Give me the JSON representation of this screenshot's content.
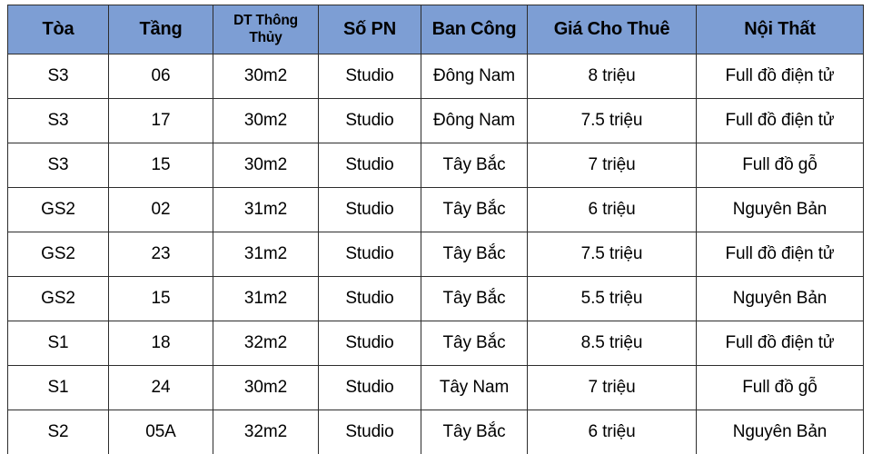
{
  "table": {
    "columns": [
      {
        "key": "toa",
        "label": "Tòa",
        "two_line": false
      },
      {
        "key": "tang",
        "label": "Tầng",
        "two_line": false
      },
      {
        "key": "dt",
        "label": "DT Thông Thủy",
        "two_line": true
      },
      {
        "key": "sopn",
        "label": "Số PN",
        "two_line": false
      },
      {
        "key": "bancong",
        "label": "Ban Công",
        "two_line": false
      },
      {
        "key": "gia",
        "label": "Giá Cho Thuê",
        "two_line": false
      },
      {
        "key": "noithat",
        "label": "Nội Thất",
        "two_line": false
      }
    ],
    "header_line1": "DT Thông",
    "header_line2": "Thủy",
    "rows": [
      {
        "toa": "S3",
        "tang": "06",
        "dt": "30m2",
        "sopn": "Studio",
        "bancong": "Đông Nam",
        "gia": "8 triệu",
        "noithat": "Full đồ điện tử"
      },
      {
        "toa": "S3",
        "tang": "17",
        "dt": "30m2",
        "sopn": "Studio",
        "bancong": "Đông Nam",
        "gia": "7.5 triệu",
        "noithat": "Full đồ điện tử"
      },
      {
        "toa": "S3",
        "tang": "15",
        "dt": "30m2",
        "sopn": "Studio",
        "bancong": "Tây Bắc",
        "gia": "7 triệu",
        "noithat": "Full đồ gỗ"
      },
      {
        "toa": "GS2",
        "tang": "02",
        "dt": "31m2",
        "sopn": "Studio",
        "bancong": "Tây Bắc",
        "gia": "6 triệu",
        "noithat": "Nguyên Bản"
      },
      {
        "toa": "GS2",
        "tang": "23",
        "dt": "31m2",
        "sopn": "Studio",
        "bancong": "Tây Bắc",
        "gia": "7.5 triệu",
        "noithat": "Full đồ điện tử"
      },
      {
        "toa": "GS2",
        "tang": "15",
        "dt": "31m2",
        "sopn": "Studio",
        "bancong": "Tây Bắc",
        "gia": "5.5 triệu",
        "noithat": "Nguyên Bản"
      },
      {
        "toa": "S1",
        "tang": "18",
        "dt": "32m2",
        "sopn": "Studio",
        "bancong": "Tây Bắc",
        "gia": "8.5 triệu",
        "noithat": "Full đồ điện tử"
      },
      {
        "toa": "S1",
        "tang": "24",
        "dt": "30m2",
        "sopn": "Studio",
        "bancong": "Tây Nam",
        "gia": "7 triệu",
        "noithat": "Full đồ gỗ"
      },
      {
        "toa": "S2",
        "tang": "05A",
        "dt": "32m2",
        "sopn": "Studio",
        "bancong": "Tây Bắc",
        "gia": "6 triệu",
        "noithat": "Nguyên Bản"
      }
    ]
  },
  "colors": {
    "header_background": "#7d9ed4",
    "border": "#2d2d2d",
    "cell_background": "#ffffff",
    "text": "#000000"
  }
}
